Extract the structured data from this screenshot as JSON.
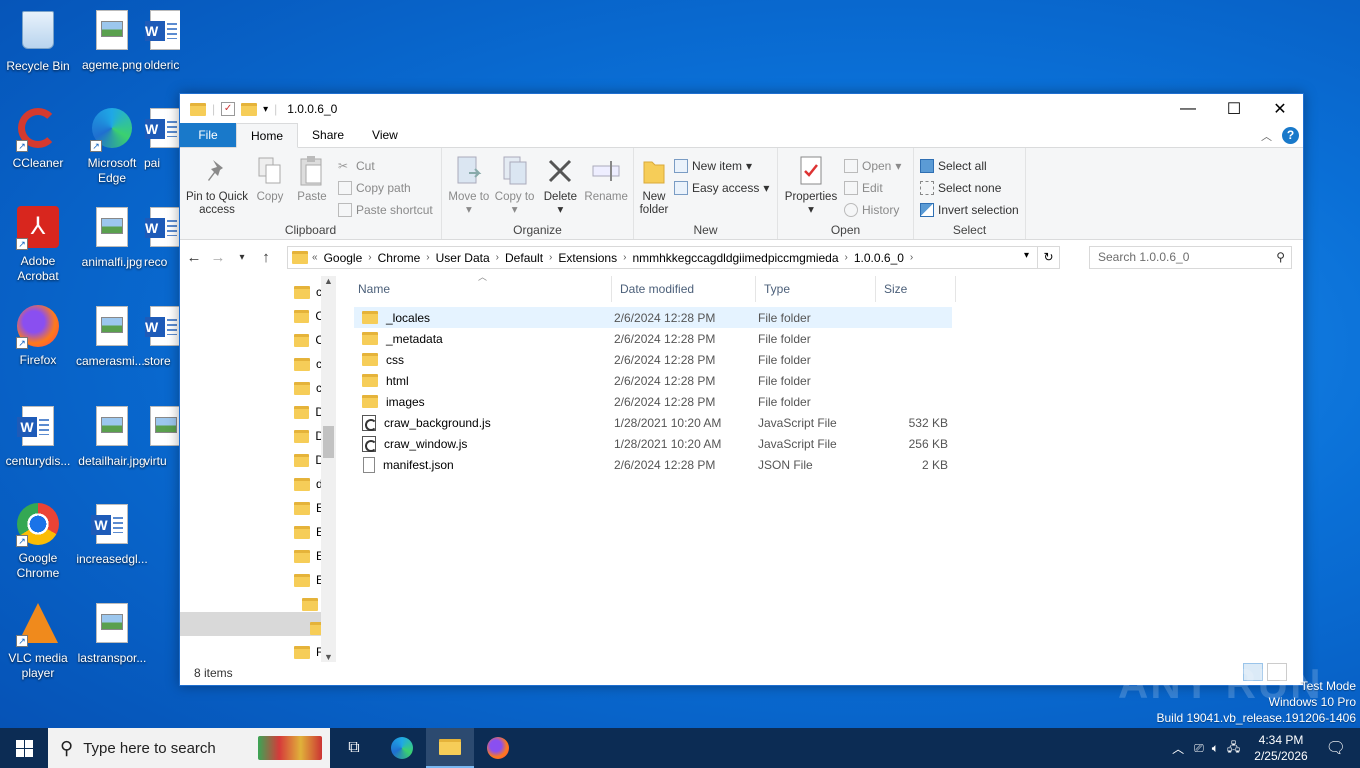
{
  "desktop": {
    "icons": [
      {
        "label": "Recycle Bin",
        "icon": "recycle-bin-icon"
      },
      {
        "label": "ageme.png",
        "icon": "image-file-icon"
      },
      {
        "label": "olderice.rtf",
        "icon": "word-doc-icon"
      },
      {
        "label": "CCleaner",
        "icon": "ccleaner-icon"
      },
      {
        "label": "Microsoft Edge",
        "icon": "edge-icon"
      },
      {
        "label": "pai",
        "icon": "word-doc-icon"
      },
      {
        "label": "Adobe Acrobat",
        "icon": "acrobat-icon"
      },
      {
        "label": "animalfi.jpg",
        "icon": "image-file-icon"
      },
      {
        "label": "reco",
        "icon": "word-doc-icon"
      },
      {
        "label": "Firefox",
        "icon": "firefox-icon"
      },
      {
        "label": "camerasmi....",
        "icon": "image-file-icon"
      },
      {
        "label": "store",
        "icon": "word-doc-icon"
      },
      {
        "label": "centurydis...",
        "icon": "word-doc-icon"
      },
      {
        "label": "detailhair.jpg",
        "icon": "image-file-icon"
      },
      {
        "label": "virtu",
        "icon": "image-file-icon"
      },
      {
        "label": "Google Chrome",
        "icon": "chrome-icon"
      },
      {
        "label": "increasedgl...",
        "icon": "word-doc-icon"
      },
      {
        "label": "VLC media player",
        "icon": "vlc-icon"
      },
      {
        "label": "lastranspor...",
        "icon": "image-file-icon"
      }
    ]
  },
  "window": {
    "title": "1.0.0.6_0",
    "controls": {
      "minimize": "—",
      "maximize": "☐",
      "close": "✕"
    }
  },
  "ribbon": {
    "tabs": [
      "File",
      "Home",
      "Share",
      "View"
    ],
    "clipboard": {
      "pin": "Pin to Quick access",
      "copy": "Copy",
      "paste": "Paste",
      "cut": "Cut",
      "copy_path": "Copy path",
      "paste_shortcut": "Paste shortcut",
      "label": "Clipboard"
    },
    "organize": {
      "move_to": "Move to",
      "copy_to": "Copy to",
      "delete": "Delete",
      "rename": "Rename",
      "label": "Organize"
    },
    "new": {
      "new_folder": "New folder",
      "new_item": "New item",
      "easy_access": "Easy access",
      "label": "New"
    },
    "open": {
      "properties": "Properties",
      "open": "Open",
      "edit": "Edit",
      "history": "History",
      "label": "Open"
    },
    "select": {
      "select_all": "Select all",
      "select_none": "Select none",
      "invert": "Invert selection",
      "label": "Select"
    }
  },
  "address": {
    "crumbs": [
      "Google",
      "Chrome",
      "User Data",
      "Default",
      "Extensions",
      "nmmhkkegccagdldgiimedpiccmgmieda",
      "1.0.0.6_0"
    ],
    "search_placeholder": "Search 1.0.0.6_0"
  },
  "navpane": {
    "items": [
      "c",
      "C",
      "C",
      "c",
      "c",
      "D",
      "D",
      "D",
      "d",
      "E",
      "E",
      "E",
      "E",
      "",
      "",
      "F"
    ]
  },
  "columns": {
    "name": "Name",
    "date": "Date modified",
    "type": "Type",
    "size": "Size"
  },
  "files": [
    {
      "name": "_locales",
      "date": "2/6/2024 12:28 PM",
      "type": "File folder",
      "size": "",
      "kind": "folder"
    },
    {
      "name": "_metadata",
      "date": "2/6/2024 12:28 PM",
      "type": "File folder",
      "size": "",
      "kind": "folder"
    },
    {
      "name": "css",
      "date": "2/6/2024 12:28 PM",
      "type": "File folder",
      "size": "",
      "kind": "folder"
    },
    {
      "name": "html",
      "date": "2/6/2024 12:28 PM",
      "type": "File folder",
      "size": "",
      "kind": "folder"
    },
    {
      "name": "images",
      "date": "2/6/2024 12:28 PM",
      "type": "File folder",
      "size": "",
      "kind": "folder"
    },
    {
      "name": "craw_background.js",
      "date": "1/28/2021 10:20 AM",
      "type": "JavaScript File",
      "size": "532 KB",
      "kind": "js"
    },
    {
      "name": "craw_window.js",
      "date": "1/28/2021 10:20 AM",
      "type": "JavaScript File",
      "size": "256 KB",
      "kind": "js"
    },
    {
      "name": "manifest.json",
      "date": "2/6/2024 12:28 PM",
      "type": "JSON File",
      "size": "2 KB",
      "kind": "json"
    }
  ],
  "status": {
    "count": "8 items"
  },
  "watermark": {
    "line1": "Test Mode",
    "line2": "Windows 10 Pro",
    "line3": "Build 19041.vb_release.191206-1406",
    "brand": "ANY RUN"
  },
  "taskbar": {
    "search_placeholder": "Type here to search",
    "time": "4:34 PM",
    "date": "2/25/2026"
  }
}
